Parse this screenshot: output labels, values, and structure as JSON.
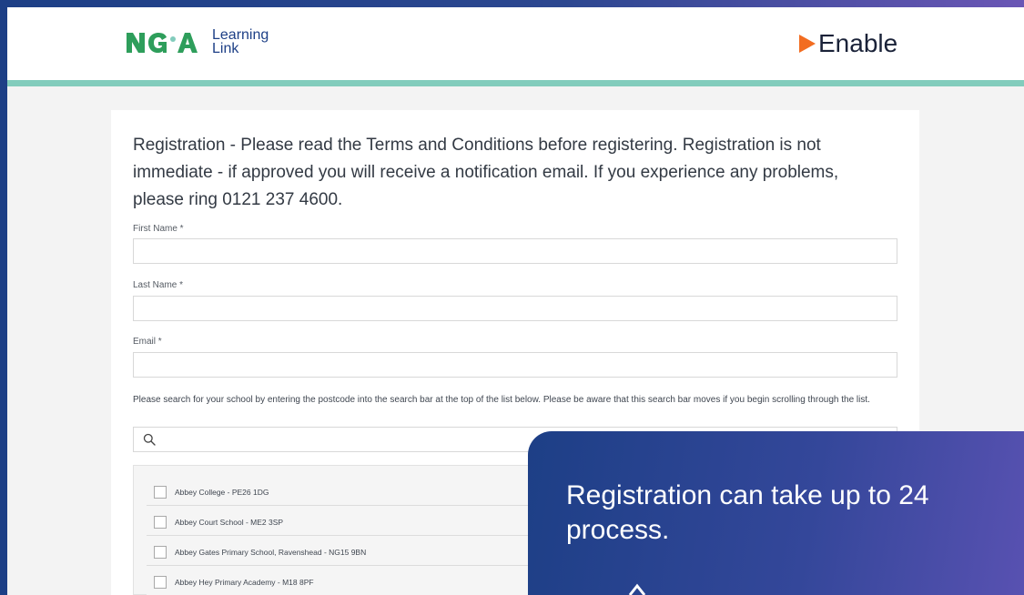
{
  "header": {
    "nga_logo_text": "Learning\nLink",
    "enable_logo_text": "Enable"
  },
  "form": {
    "heading": "Registration - Please read the Terms and Conditions before registering. Registration is not immediate - if approved you will receive a notification email. If you experience any problems, please ring 0121 237 4600.",
    "first_name_label": "First Name *",
    "last_name_label": "Last Name *",
    "email_label": "Email *",
    "school_help_text": "Please search for your school by entering the postcode into the search bar at the top of the list below. Please be aware that this search bar moves if you begin scrolling through the list."
  },
  "school_list": {
    "items": [
      "Abbey College - PE26 1DG",
      "Abbey Court School - ME2 3SP",
      "Abbey Gates Primary School, Ravenshead - NG15 9BN",
      "Abbey Hey Primary Academy - M18 8PF"
    ]
  },
  "callout": {
    "text": "Registration can take up to 24\nprocess."
  },
  "colors": {
    "brand_navy": "#1d3f86",
    "brand_teal": "#82ccbc",
    "brand_green": "#2e9e5b",
    "enable_orange": "#f26d21",
    "callout_purple": "#5b52b3"
  },
  "icons": {
    "search": "search-icon",
    "callout_partial": "chevron-up-icon"
  }
}
